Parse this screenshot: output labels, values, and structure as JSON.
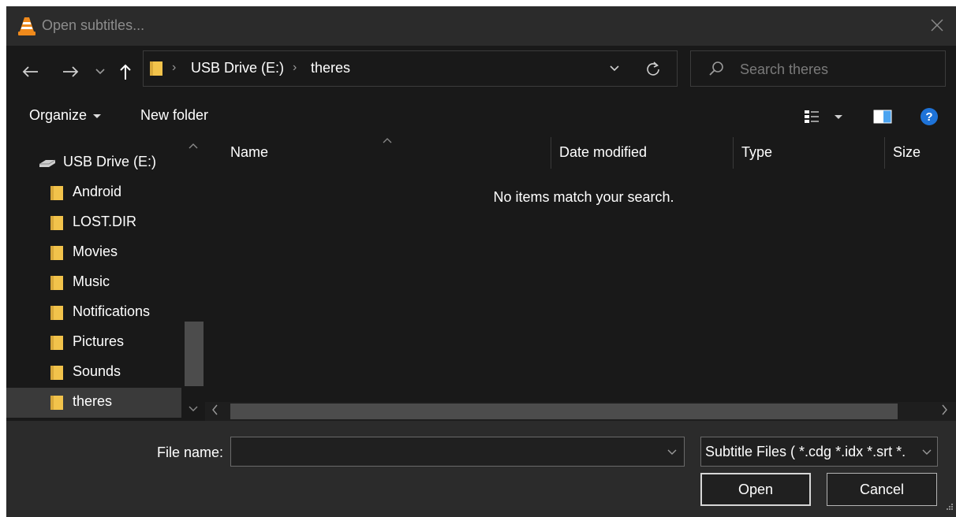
{
  "window": {
    "title": "Open subtitles...",
    "app_icon": "vlc-cone-icon",
    "close_icon": "close-icon"
  },
  "nav": {
    "back_icon": "back-arrow-icon",
    "forward_icon": "forward-arrow-icon",
    "recent_icon": "chevron-down-icon",
    "up_icon": "up-arrow-icon",
    "breadcrumb": [
      "USB Drive (E:)",
      "theres"
    ],
    "search_placeholder": "Search theres"
  },
  "toolbar": {
    "organize_label": "Organize",
    "new_folder_label": "New folder"
  },
  "sidebar": {
    "items": [
      {
        "label": "USB Drive (E:)",
        "icon": "drive-icon"
      },
      {
        "label": "Android",
        "icon": "folder-icon"
      },
      {
        "label": "LOST.DIR",
        "icon": "folder-icon"
      },
      {
        "label": "Movies",
        "icon": "folder-icon"
      },
      {
        "label": "Music",
        "icon": "folder-icon"
      },
      {
        "label": "Notifications",
        "icon": "folder-icon"
      },
      {
        "label": "Pictures",
        "icon": "folder-icon"
      },
      {
        "label": "Sounds",
        "icon": "folder-icon"
      },
      {
        "label": "theres",
        "icon": "folder-icon",
        "selected": true
      }
    ]
  },
  "file_list": {
    "columns": [
      "Name",
      "Date modified",
      "Type",
      "Size"
    ],
    "empty_message": "No items match your search."
  },
  "bottom": {
    "file_name_label": "File name:",
    "file_name_value": "",
    "filter_value": "Subtitle Files ( *.cdg *.idx *.srt *.",
    "open_label": "Open",
    "cancel_label": "Cancel"
  },
  "colors": {
    "background": "#202020",
    "pane": "#191919",
    "folder": "#f2c34b",
    "help_blue": "#1e73d8"
  }
}
